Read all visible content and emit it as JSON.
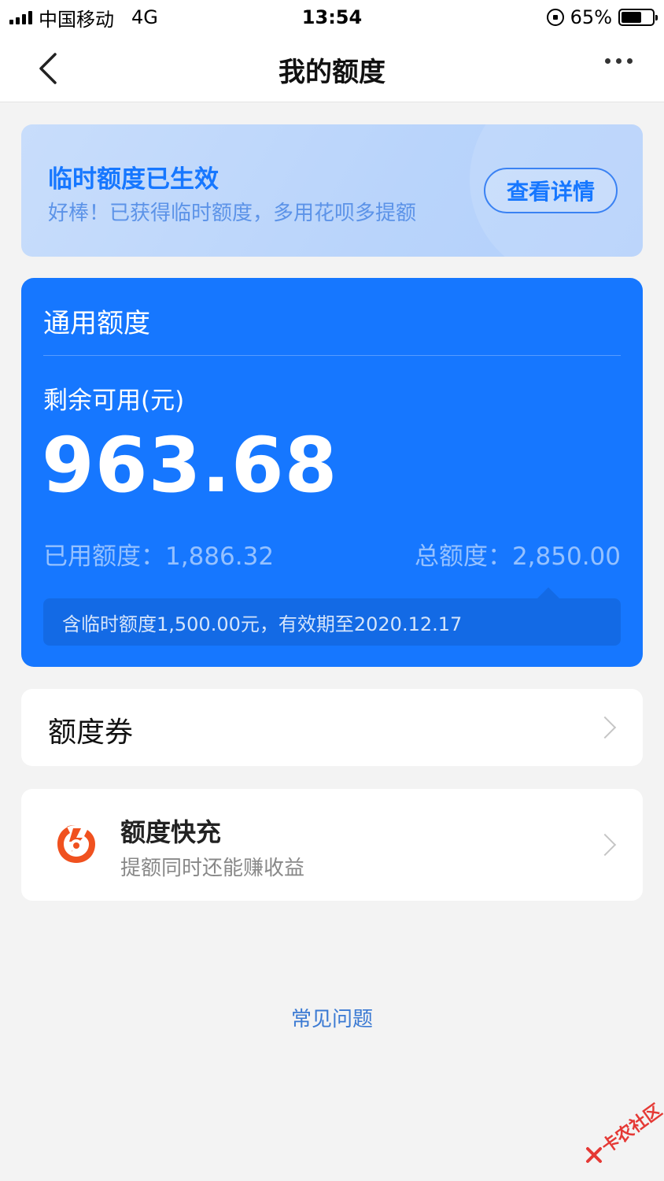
{
  "status_bar": {
    "carrier": "中国移动",
    "network": "4G",
    "time": "13:54",
    "battery": "65%",
    "battery_level": 0.65
  },
  "nav": {
    "title": "我的额度"
  },
  "temp_banner": {
    "title": "临时额度已生效",
    "subtitle": "好棒！已获得临时额度，多用花呗多提额",
    "button_label": "查看详情"
  },
  "quota": {
    "title": "通用额度",
    "remain_label": "剩余可用(元)",
    "remain_amount": "963.68",
    "used_label": "已用额度：",
    "used_amount": "1,886.32",
    "total_label": "总额度：",
    "total_amount": "2,850.00",
    "temp_note": "含临时额度1,500.00元，有效期至2020.12.17"
  },
  "voucher": {
    "label": "额度券"
  },
  "quick_charge": {
    "title": "额度快充",
    "subtitle": "提额同时还能赚收益"
  },
  "faq": {
    "label": "常见问题"
  },
  "watermark": {
    "text": "卡农社区"
  },
  "colors": {
    "accent": "#1677ff",
    "banner_bg": "#bcd6fb",
    "quick_icon": "#f0511f",
    "page_bg": "#f3f3f3"
  },
  "icons": {
    "back": "chevron-left-icon",
    "more": "more-dots-icon",
    "chevron": "chevron-right-icon",
    "quick": "quick-charge-icon"
  }
}
